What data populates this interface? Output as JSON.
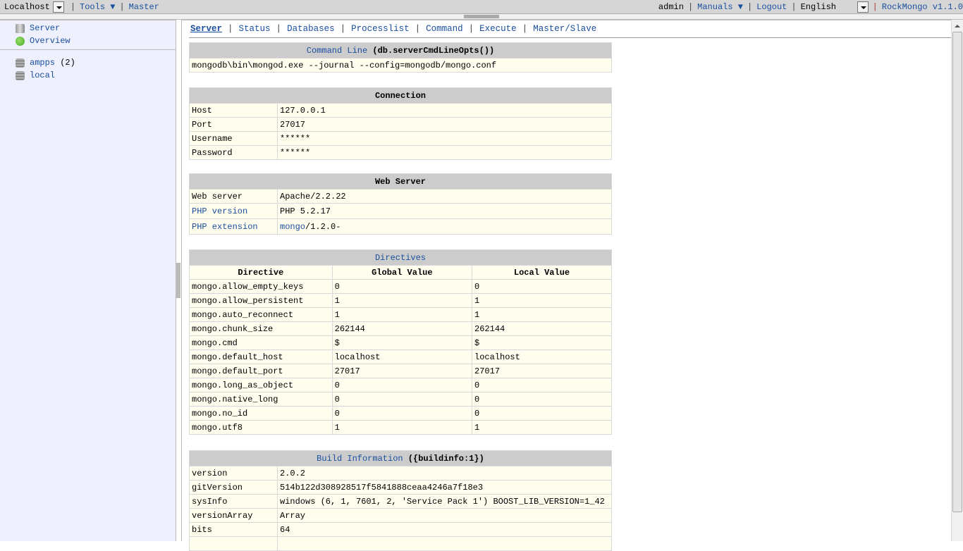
{
  "topbar": {
    "host": "Localhost",
    "tools": "Tools ▼",
    "master": "Master",
    "user": "admin",
    "manuals": "Manuals ▼",
    "logout": "Logout",
    "language": "English",
    "app": "RockMongo v1.1.0"
  },
  "sidebar": {
    "server": "Server",
    "overview": "Overview",
    "dbs": [
      {
        "name": "ampps",
        "count": "(2)"
      },
      {
        "name": "local",
        "count": ""
      }
    ]
  },
  "tabs": [
    "Server",
    "Status",
    "Databases",
    "Processlist",
    "Command",
    "Execute",
    "Master/Slave"
  ],
  "command_line": {
    "title": "Command Line",
    "suffix": "(db.serverCmdLineOpts())",
    "value": "mongodb\\bin\\mongod.exe --journal --config=mongodb/mongo.conf"
  },
  "connection": {
    "title": "Connection",
    "rows": [
      [
        "Host",
        "127.0.0.1"
      ],
      [
        "Port",
        "27017"
      ],
      [
        "Username",
        "******"
      ],
      [
        "Password",
        "******"
      ]
    ]
  },
  "web_server": {
    "title": "Web Server",
    "rows": [
      [
        "Web server",
        "Apache/2.2.22"
      ],
      [
        "PHP version",
        "PHP 5.2.17"
      ],
      [
        "PHP extension",
        "mongo",
        "/1.2.0-"
      ]
    ]
  },
  "directives": {
    "title": "Directives",
    "headers": [
      "Directive",
      "Global Value",
      "Local Value"
    ],
    "rows": [
      [
        "mongo.allow_empty_keys",
        "0",
        "0"
      ],
      [
        "mongo.allow_persistent",
        "1",
        "1"
      ],
      [
        "mongo.auto_reconnect",
        "1",
        "1"
      ],
      [
        "mongo.chunk_size",
        "262144",
        "262144"
      ],
      [
        "mongo.cmd",
        "$",
        "$"
      ],
      [
        "mongo.default_host",
        "localhost",
        "localhost"
      ],
      [
        "mongo.default_port",
        "27017",
        "27017"
      ],
      [
        "mongo.long_as_object",
        "0",
        "0"
      ],
      [
        "mongo.native_long",
        "0",
        "0"
      ],
      [
        "mongo.no_id",
        "0",
        "0"
      ],
      [
        "mongo.utf8",
        "1",
        "1"
      ]
    ]
  },
  "build_info": {
    "title": "Build Information",
    "suffix": "({buildinfo:1})",
    "rows": [
      [
        "version",
        "2.0.2"
      ],
      [
        "gitVersion",
        "514b122d308928517f5841888ceaa4246a7f18e3"
      ],
      [
        "sysInfo",
        "windows (6, 1, 7601, 2, 'Service Pack 1') BOOST_LIB_VERSION=1_42"
      ],
      [
        "versionArray",
        "Array"
      ],
      [
        "bits",
        "64"
      ],
      [
        "",
        ""
      ]
    ]
  }
}
